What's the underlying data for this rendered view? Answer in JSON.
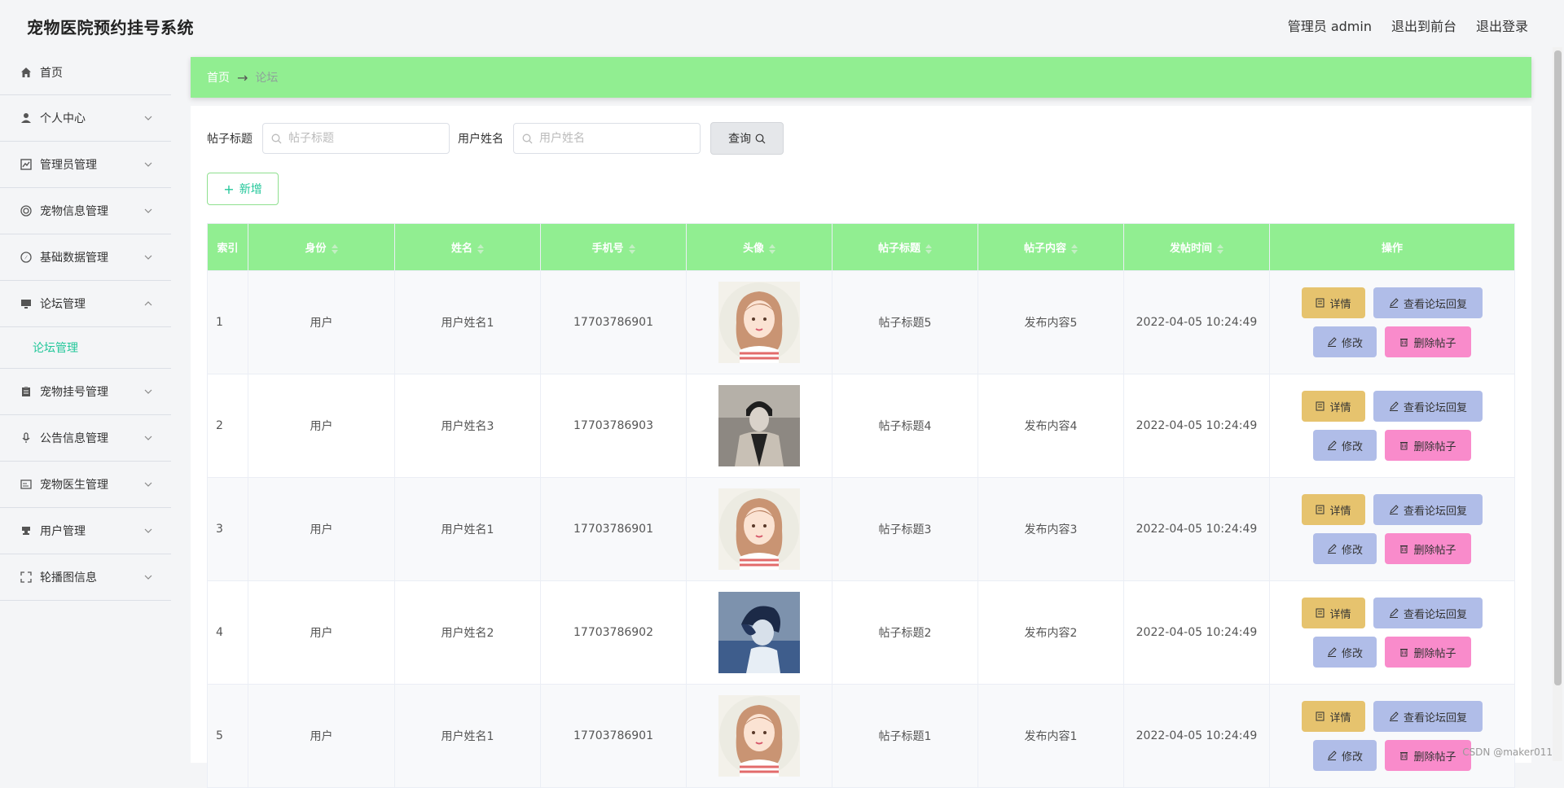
{
  "app": {
    "title": "宠物医院预约挂号系统"
  },
  "header": {
    "user_label": "管理员 admin",
    "front_link": "退出到前台",
    "logout_link": "退出登录"
  },
  "sidebar": {
    "items": [
      {
        "label": "首页",
        "icon": "home-icon",
        "expandable": false
      },
      {
        "label": "个人中心",
        "icon": "user-icon",
        "expandable": true
      },
      {
        "label": "管理员管理",
        "icon": "chart-icon",
        "expandable": true
      },
      {
        "label": "宠物信息管理",
        "icon": "target-icon",
        "expandable": true
      },
      {
        "label": "基础数据管理",
        "icon": "compass-icon",
        "expandable": true
      },
      {
        "label": "论坛管理",
        "icon": "monitor-icon",
        "expandable": true,
        "open": true,
        "children": [
          "论坛管理"
        ]
      },
      {
        "label": "宠物挂号管理",
        "icon": "clipboard-icon",
        "expandable": true
      },
      {
        "label": "公告信息管理",
        "icon": "microphone-icon",
        "expandable": true
      },
      {
        "label": "宠物医生管理",
        "icon": "card-icon",
        "expandable": true
      },
      {
        "label": "用户管理",
        "icon": "stamp-icon",
        "expandable": true
      },
      {
        "label": "轮播图信息",
        "icon": "fullscreen-icon",
        "expandable": true
      }
    ]
  },
  "breadcrumb": {
    "home": "首页",
    "separator": "→",
    "current": "论坛"
  },
  "search": {
    "title_label": "帖子标题",
    "title_placeholder": "帖子标题",
    "user_label": "用户姓名",
    "user_placeholder": "用户姓名",
    "query_button": "查询"
  },
  "add_button": "新增",
  "table": {
    "columns": [
      "索引",
      "身份",
      "姓名",
      "手机号",
      "头像",
      "帖子标题",
      "帖子内容",
      "发帖时间",
      "操作"
    ],
    "rows": [
      {
        "index": "1",
        "role": "用户",
        "name": "用户姓名1",
        "phone": "17703786901",
        "avatar": "girl",
        "title": "帖子标题5",
        "content": "发布内容5",
        "time": "2022-04-05 10:24:49"
      },
      {
        "index": "2",
        "role": "用户",
        "name": "用户姓名3",
        "phone": "17703786903",
        "avatar": "man",
        "title": "帖子标题4",
        "content": "发布内容4",
        "time": "2022-04-05 10:24:49"
      },
      {
        "index": "3",
        "role": "用户",
        "name": "用户姓名1",
        "phone": "17703786901",
        "avatar": "girl",
        "title": "帖子标题3",
        "content": "发布内容3",
        "time": "2022-04-05 10:24:49"
      },
      {
        "index": "4",
        "role": "用户",
        "name": "用户姓名2",
        "phone": "17703786902",
        "avatar": "boy",
        "title": "帖子标题2",
        "content": "发布内容2",
        "time": "2022-04-05 10:24:49"
      },
      {
        "index": "5",
        "role": "用户",
        "name": "用户姓名1",
        "phone": "17703786901",
        "avatar": "girl",
        "title": "帖子标题1",
        "content": "发布内容1",
        "time": "2022-04-05 10:24:49"
      }
    ],
    "actions": {
      "detail": "详情",
      "view_replies": "查看论坛回复",
      "edit": "修改",
      "delete": "删除帖子"
    }
  },
  "colors": {
    "accent_green": "#91ee91",
    "teal_text": "#23c79a",
    "detail_btn": "#e6c36e",
    "view_btn": "#b0bde8",
    "delete_btn": "#f98bcb"
  },
  "watermark": "CSDN @maker011"
}
